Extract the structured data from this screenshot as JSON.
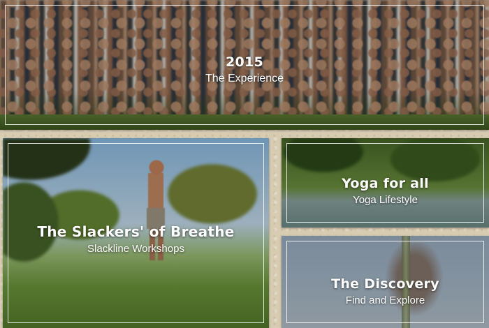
{
  "tiles": [
    {
      "title": "2015",
      "subtitle": "The Experience"
    },
    {
      "title": "The Slackers' of Breathe",
      "subtitle": "Slackline Workshops"
    },
    {
      "title": "Yoga for all",
      "subtitle": "Yoga Lifestyle"
    },
    {
      "title": "The Discovery",
      "subtitle": "Find and Explore"
    }
  ]
}
